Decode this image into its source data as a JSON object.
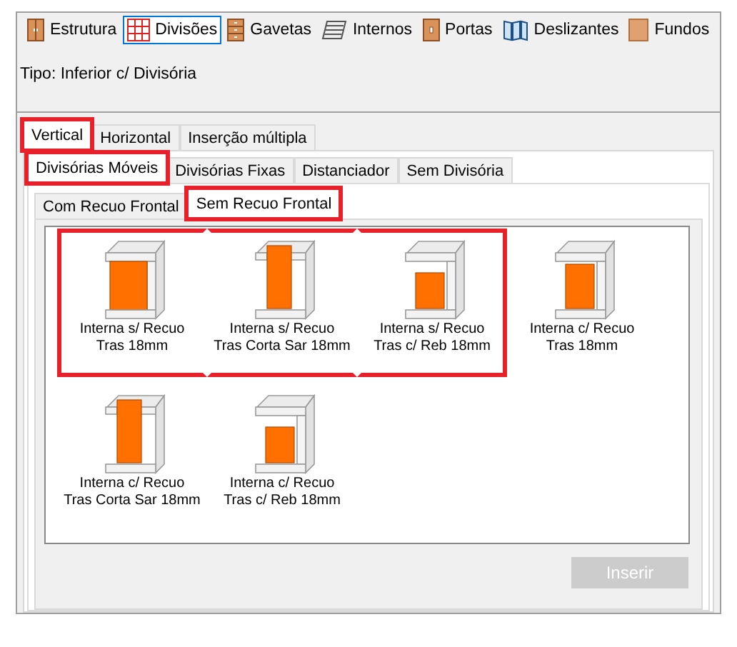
{
  "toolbar": [
    {
      "label": "Estrutura",
      "kind": "cabinet",
      "selected": false
    },
    {
      "label": "Divisões",
      "kind": "grid",
      "selected": true
    },
    {
      "label": "Gavetas",
      "kind": "drawers",
      "selected": false
    },
    {
      "label": "Internos",
      "kind": "shelves",
      "selected": false
    },
    {
      "label": "Portas",
      "kind": "door",
      "selected": false
    },
    {
      "label": "Deslizantes",
      "kind": "sliding",
      "selected": false
    },
    {
      "label": "Fundos",
      "kind": "back",
      "selected": false
    }
  ],
  "type_label": "Tipo: Inferior c/ Divisória",
  "tabs": [
    {
      "label": "Vertical",
      "selected": true,
      "highlighted": true
    },
    {
      "label": "Horizontal",
      "selected": false,
      "highlighted": false
    },
    {
      "label": "Inserção múltipla",
      "selected": false,
      "highlighted": false
    }
  ],
  "subtabs": [
    {
      "label": "Divisórias Móveis",
      "selected": true,
      "highlighted": true
    },
    {
      "label": "Divisórias Fixas",
      "selected": false,
      "highlighted": false
    },
    {
      "label": "Distanciador",
      "selected": false,
      "highlighted": false
    },
    {
      "label": "Sem Divisória",
      "selected": false,
      "highlighted": false
    }
  ],
  "innertabs": [
    {
      "label": "Com Recuo Frontal",
      "selected": false,
      "highlighted": false
    },
    {
      "label": "Sem Recuo Frontal",
      "selected": true,
      "highlighted": true
    }
  ],
  "items": [
    {
      "line1": "Interna s/ Recuo",
      "line2": "Tras 18mm",
      "kind": "plain",
      "highlighted": true
    },
    {
      "line1": "Interna s/ Recuo",
      "line2": "Tras Corta Sar 18mm",
      "kind": "corta",
      "highlighted": true
    },
    {
      "line1": "Interna s/ Recuo",
      "line2": "Tras c/ Reb 18mm",
      "kind": "reb",
      "highlighted": true
    },
    {
      "line1": "Interna c/ Recuo",
      "line2": "Tras 18mm",
      "kind": "plain-recuo",
      "highlighted": false
    },
    {
      "line1": "Interna c/ Recuo",
      "line2": "Tras Corta Sar 18mm",
      "kind": "corta",
      "highlighted": false
    },
    {
      "line1": "Interna c/ Recuo",
      "line2": "Tras c/ Reb 18mm",
      "kind": "reb",
      "highlighted": false
    }
  ],
  "insert_button": {
    "label": "Inserir",
    "disabled": true
  }
}
